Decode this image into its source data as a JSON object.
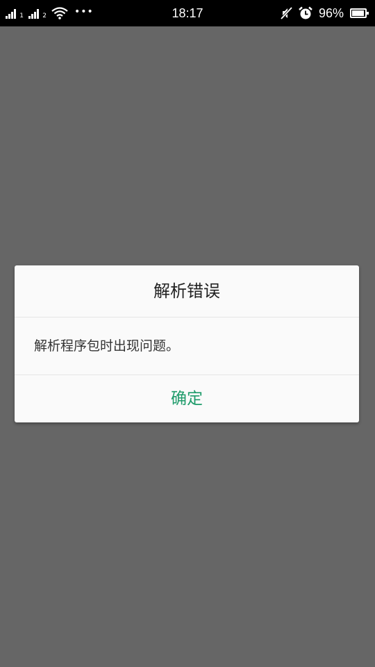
{
  "status_bar": {
    "sim1_label": "1",
    "sim2_label": "2",
    "more_indicator": "•••",
    "time": "18:17",
    "battery_level": "96%",
    "battery_fill_fraction": 0.96,
    "icons": [
      "signal-sim1-icon",
      "signal-sim2-icon",
      "wifi-icon",
      "more-dots-icon",
      "mute-icon",
      "alarm-icon",
      "battery-icon"
    ]
  },
  "dialog": {
    "title": "解析错误",
    "message": "解析程序包时出现问题。",
    "confirm_label": "确定"
  },
  "colors": {
    "background_dim": "#666666",
    "status_bar": "#000000",
    "dialog_bg": "#fafafa",
    "accent": "#1e9b6a"
  }
}
